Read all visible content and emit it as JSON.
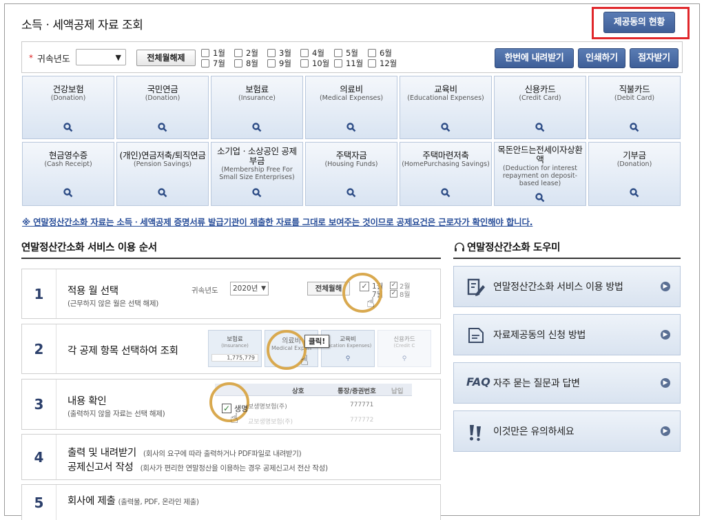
{
  "page_title": "소득ㆍ세액공제 자료 조회",
  "status_button": "제공동의 현황",
  "toolbar": {
    "required_mark": "*",
    "year_label": "귀속년도",
    "year_value": "",
    "clear_months_label": "전체월해제",
    "months": [
      "1월",
      "2월",
      "3월",
      "4월",
      "5월",
      "6월",
      "7월",
      "8월",
      "9월",
      "10월",
      "11월",
      "12월"
    ],
    "download_label": "한번에 내려받기",
    "print_label": "인쇄하기",
    "braille_label": "점자받기"
  },
  "categories": [
    {
      "kr": "건강보험",
      "en": "(Donation)"
    },
    {
      "kr": "국민연금",
      "en": "(Donation)"
    },
    {
      "kr": "보험료",
      "en": "(Insurance)"
    },
    {
      "kr": "의료비",
      "en": "(Medical Expenses)"
    },
    {
      "kr": "교육비",
      "en": "(Educational Expenses)"
    },
    {
      "kr": "신용카드",
      "en": "(Credit Card)"
    },
    {
      "kr": "직불카드",
      "en": "(Debit Card)"
    },
    {
      "kr": "현금영수증",
      "en": "(Cash Receipt)"
    },
    {
      "kr": "(개인)연금저축/퇴직연금",
      "en": "(Pension Savings)"
    },
    {
      "kr": "소기업ㆍ소상공인 공제부금",
      "en": "(Membership Free For Small Size Enterprises)"
    },
    {
      "kr": "주택자금",
      "en": "(Housing Funds)"
    },
    {
      "kr": "주택마련저축",
      "en": "(HomePurchasing Savings)"
    },
    {
      "kr": "목돈안드는전세이자상환액",
      "en": "(Deduction for interest repayment on deposit-based lease)"
    },
    {
      "kr": "기부금",
      "en": "(Donation)"
    }
  ],
  "notice": "※ 연말정산간소화 자료는 소득ㆍ세액공제 증명서류 발급기관이 제출한 자료를 그대로 보여주는 것이므로 공제요건은 근로자가 확인해야 합니다.",
  "steps_section_title": "연말정산간소화 서비스 이용 순서",
  "steps": [
    {
      "num": "1",
      "title": "적용 월 선택",
      "sub": "(근무하지 않은 월은 선택 해제)"
    },
    {
      "num": "2",
      "title": "각 공제 항목 선택하여 조회",
      "sub": ""
    },
    {
      "num": "3",
      "title": "내용 확인",
      "sub": "(출력하지 않을 자료는 선택 해제)"
    },
    {
      "num": "4",
      "title": "출력 및 내려받기",
      "sub": "(회사의 요구에 따라 출력하거나 PDF파일로 내려받기)",
      "title2": "공제신고서 작성",
      "sub2": "(회사가 편리한 연말정산을 이용하는 경우 공제신고서 전산 작성)"
    },
    {
      "num": "5",
      "title": "회사에 제출",
      "sub": "(출력물, PDF, 온라인 제출)"
    }
  ],
  "step1_mock": {
    "year_label": "귀속년도",
    "year_value": "2020년",
    "clear_label": "전체월해",
    "m1": "1월",
    "m2": "2월",
    "m7": "7월",
    "m8": "8월"
  },
  "step2_mock": {
    "c1_kr": "보험료",
    "c1_en": "(Insurance)",
    "c1_val": "1,775,779",
    "c2_kr": "의료비",
    "c2_en": "Medical Expen",
    "c3_kr": "교육비",
    "c3_en": "ducation Expenses)",
    "c4_kr": "신용카드",
    "c4_en": "(Credit C",
    "tooltip": "클릭!"
  },
  "step3_mock": {
    "col1": "상호",
    "col2": "통장/증권번호",
    "col3": "납입",
    "row1_name": "생명",
    "row1_rest": "보생명보험(주)",
    "row1_no": "777771",
    "row2_name": "교보생명보험(주)",
    "row2_no": "777772"
  },
  "help_section_title": "연말정산간소화 도우미",
  "help_items": [
    {
      "icon": "document-edit-icon",
      "label": "연말정산간소화 서비스 이용 방법"
    },
    {
      "icon": "document-icon",
      "label": "자료제공동의 신청 방법"
    },
    {
      "icon": "faq-icon",
      "label": "자주 묻는 질문과 답변",
      "prefix": "FAQ"
    },
    {
      "icon": "exclamation-icon",
      "label": "이것만은 유의하세요"
    }
  ],
  "colors": {
    "accent": "#4a6aa5",
    "highlight_box": "#e0262a",
    "circle": "#d9a94f"
  }
}
